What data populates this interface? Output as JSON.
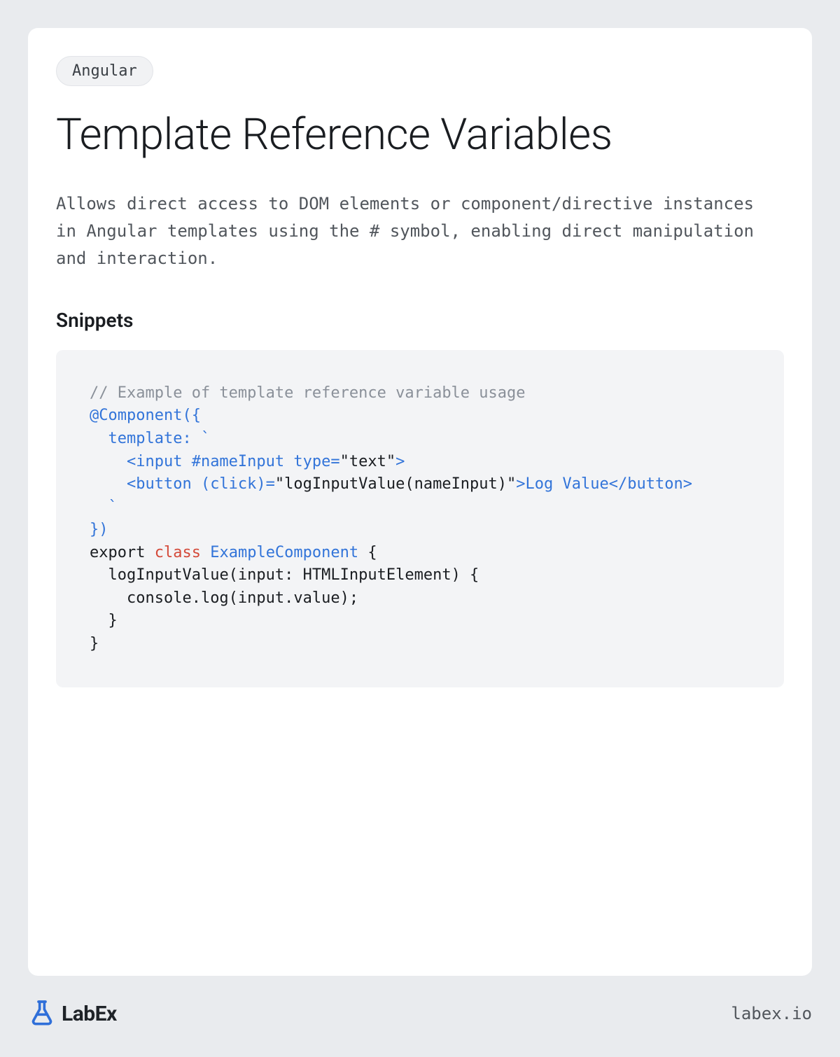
{
  "tag": "Angular",
  "title": "Template Reference Variables",
  "description": "Allows direct access to DOM elements or component/directive instances in Angular templates using the # symbol, enabling direct manipulation and interaction.",
  "snippets_heading": "Snippets",
  "code": {
    "comment": "// Example of template reference variable usage",
    "decorator": "@Component",
    "decorator_open": "({",
    "template_key": "  template:",
    "backtick1": " `",
    "line_input_open": "    <input #nameInput type=",
    "text_literal": "\"text\"",
    "line_input_close": ">",
    "line_button_a": "    <button (click)=",
    "call_literal": "\"logInputValue(nameInput)\"",
    "line_button_b": ">Log Value</button>",
    "backtick2": "  `",
    "decorator_close": "})",
    "export_kw": "export",
    "class_kw": "class",
    "class_name": "ExampleComponent",
    "class_open": " {",
    "method_sig": "  logInputValue(input: HTMLInputElement) {",
    "method_body": "    console.log(input.value);",
    "method_close": "  }",
    "class_close": "}"
  },
  "footer": {
    "brand": "LabEx",
    "url": "labex.io"
  }
}
